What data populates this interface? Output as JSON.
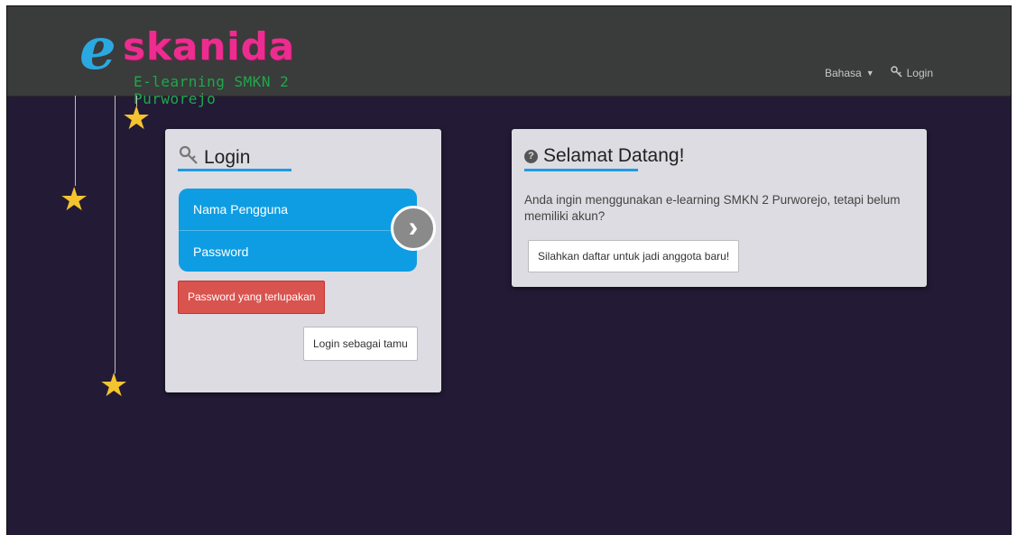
{
  "brand": {
    "logo_e": "e",
    "logo_word": "skanida",
    "tagline": "E-learning SMKN 2 Purworejo"
  },
  "nav": {
    "language_label": "Bahasa",
    "login_label": "Login"
  },
  "login_panel": {
    "title": "Login",
    "username_placeholder": "Nama Pengguna",
    "password_placeholder": "Password",
    "forgot_password": "Password yang terlupakan",
    "guest_login": "Login sebagai tamu",
    "submit_glyph": "›"
  },
  "welcome_panel": {
    "title": "Selamat Datang!",
    "message": "Anda ingin menggunakan e-learning SMKN 2 Purworejo, tetapi belum memiliki akun?",
    "signup_button": "Silahkan daftar untuk jadi anggota baru!"
  },
  "colors": {
    "background": "#231b36",
    "navbar": "#3a3b3b",
    "accent": "#1e9be4",
    "danger": "#d9534f",
    "star": "#f4c430"
  },
  "icons": [
    "key-icon",
    "question-icon",
    "star-icon",
    "chevron-right-icon",
    "caret-down-icon"
  ]
}
